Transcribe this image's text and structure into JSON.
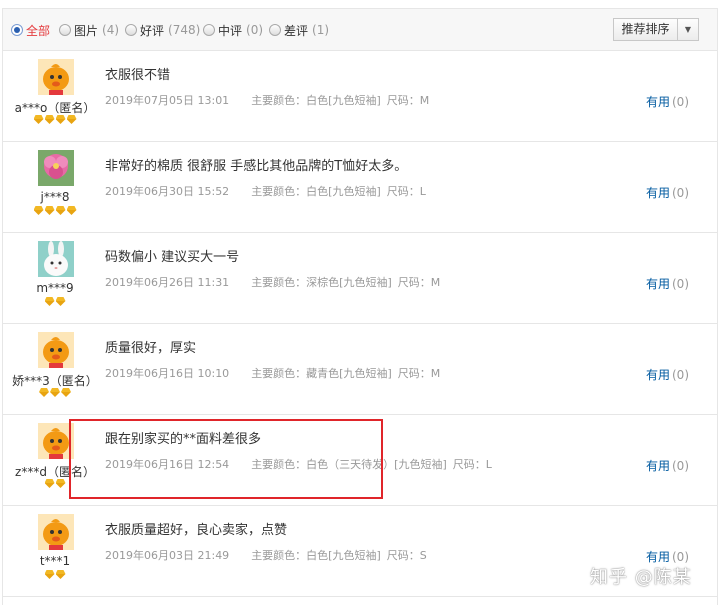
{
  "filters": [
    {
      "label": "全部",
      "count": "",
      "checked": true
    },
    {
      "label": "图片",
      "count": "(4)",
      "checked": false
    },
    {
      "label": "好评",
      "count": "(748)",
      "checked": false
    },
    {
      "label": "中评",
      "count": "(0)",
      "checked": false
    },
    {
      "label": "差评",
      "count": "(1)",
      "checked": false
    }
  ],
  "sort": {
    "label": "推荐排序",
    "caret": "▼"
  },
  "reviews": [
    {
      "user": "a***o（匿名）",
      "badges": 4,
      "avatar": "orange-mascot",
      "text": "衣服很不错",
      "date": "2019年07月05日 13:01",
      "attrs": "主要颜色：白色[九色短袖]",
      "size": "尺码：M",
      "useful": "有用",
      "useful_count": "(0)"
    },
    {
      "user": "j***8",
      "badges": 4,
      "avatar": "pink-flower",
      "text": "非常好的棉质 很舒服 手感比其他品牌的T恤好太多。",
      "date": "2019年06月30日 15:52",
      "attrs": "主要颜色：白色[九色短袖]",
      "size": "尺码：L",
      "useful": "有用",
      "useful_count": "(0)"
    },
    {
      "user": "m***9",
      "badges": 2,
      "avatar": "white-rabbit",
      "text": "码数偏小 建议买大一号",
      "date": "2019年06月26日 11:31",
      "attrs": "主要颜色：深棕色[九色短袖]",
      "size": "尺码：M",
      "useful": "有用",
      "useful_count": "(0)"
    },
    {
      "user": "娇***3（匿名）",
      "badges": 3,
      "avatar": "orange-mascot",
      "text": "质量很好，厚实",
      "date": "2019年06月16日 10:10",
      "attrs": "主要颜色：藏青色[九色短袖]",
      "size": "尺码：M",
      "useful": "有用",
      "useful_count": "(0)"
    },
    {
      "user": "z***d（匿名）",
      "badges": 2,
      "avatar": "orange-mascot",
      "text": "跟在别家买的**面料差很多",
      "date": "2019年06月16日 12:54",
      "attrs": "主要颜色：白色（三天待发）[九色短袖]",
      "size": "尺码：L",
      "useful": "有用",
      "useful_count": "(0)"
    },
    {
      "user": "t***1",
      "badges": 2,
      "avatar": "orange-mascot",
      "text": "衣服质量超好，良心卖家，点赞",
      "date": "2019年06月03日 21:49",
      "attrs": "主要颜色：白色[九色短袖]",
      "size": "尺码：S",
      "useful": "有用",
      "useful_count": "(0)"
    }
  ],
  "watermark": "知乎 @陈某",
  "colors": {
    "accent_red": "#e4393c",
    "link_blue": "#005aa0",
    "annotation_red": "#e0252a",
    "badge_gold": "#f2b824"
  }
}
